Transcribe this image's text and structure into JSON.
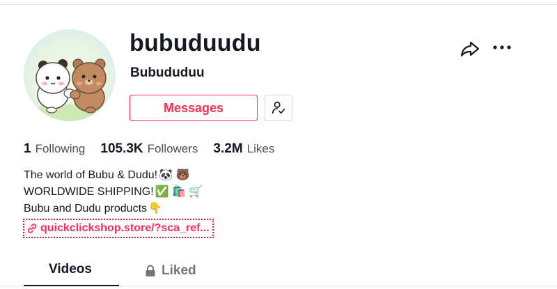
{
  "profile": {
    "username": "bubuduudu",
    "nickname": "Bubududuu",
    "avatar_icon": "bear-panda-avatar"
  },
  "actions": {
    "message_label": "Messages",
    "follow_icon": "user-check-icon",
    "share_icon": "share-arrow-icon",
    "more_icon": "more-dots-icon",
    "accent_color": "#fe2c55"
  },
  "stats": [
    {
      "value": "1",
      "label": "Following"
    },
    {
      "value": "105.3K",
      "label": "Followers"
    },
    {
      "value": "3.2M",
      "label": "Likes"
    }
  ],
  "bio": {
    "line1_text": "The world of Bubu & Dudu!",
    "line1_emoji": "🐼 🐻",
    "line2_text": "WORLDWIDE SHIPPING!",
    "line2_emoji": "✅ 🛍️ 🛒",
    "line3_text": "Bubu and Dudu products",
    "line3_emoji": "👇"
  },
  "link": {
    "text": "quickclickshop.store/?sca_ref...",
    "icon": "link-icon"
  },
  "tabs": {
    "videos": "Videos",
    "liked": "Liked",
    "liked_icon": "lock-icon"
  }
}
